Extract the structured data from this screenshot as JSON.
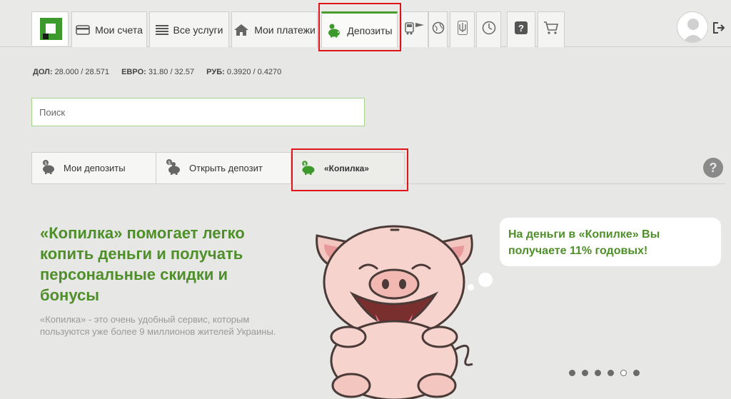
{
  "nav": {
    "logo_name": "privatbank-logo",
    "tabs": [
      {
        "label": "Мои счета",
        "icon": "card-icon"
      },
      {
        "label": "Все услуги",
        "icon": "list-icon"
      },
      {
        "label": "Мои платежи",
        "icon": "house-icon"
      },
      {
        "label": "Депозиты",
        "icon": "piggy-bank-icon",
        "active": true
      }
    ],
    "icon_tabs": [
      "transport-icon",
      "globe-icon",
      "trident-icon",
      "timer-icon",
      "help-icon",
      "cart-icon"
    ],
    "avatar": "user-avatar",
    "logout": "logout-icon"
  },
  "rates": [
    {
      "label": "ДОЛ:",
      "value": "28.000 / 28.571"
    },
    {
      "label": "ЕВРО:",
      "value": "31.80 / 32.57"
    },
    {
      "label": "РУБ:",
      "value": "0.3920 / 0.4270"
    }
  ],
  "search": {
    "placeholder": "Поиск",
    "value": ""
  },
  "subtabs": [
    {
      "label": "Мои депозиты",
      "icon": "piggy-coin-icon"
    },
    {
      "label": "Открыть депозит",
      "icon": "piggy-coins-icon"
    },
    {
      "label": "«Копилка»",
      "icon": "green-piggy-icon",
      "active": true
    }
  ],
  "hero": {
    "title": "«Копилка» помогает легко копить деньги и получать персональные скидки и бонусы",
    "description": "«Копилка» - это очень удобный сервис, которым пользуются уже более 9 миллионов жителей Украины.",
    "bubble": "На деньги в «Копилке» Вы получаете 11% годовых!"
  },
  "carousel": {
    "count": 6,
    "active_index": 4
  },
  "colors": {
    "accent": "#4e8f2a",
    "highlight": "#e0151b",
    "brand": "#3c9a2c"
  }
}
